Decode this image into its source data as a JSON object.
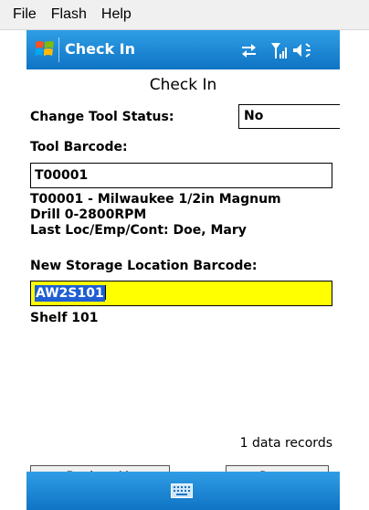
{
  "menubar": {
    "items": [
      "File",
      "Flash",
      "Help"
    ]
  },
  "titlebar": {
    "title": "Check In"
  },
  "form": {
    "heading": "Check In",
    "change_status_label": "Change Tool Status:",
    "change_status_value": "No",
    "tool_barcode_label": "Tool Barcode:",
    "tool_barcode_value": "T00001",
    "tool_description_line1": "T00001 - Milwaukee 1/2in Magnum",
    "tool_description_line2": "Drill 0-2800RPM",
    "last_loc_line": "Last Loc/Emp/Cont:  Doe, Mary",
    "storage_label": "New Storage Location Barcode:",
    "storage_value": "AW2S101",
    "storage_description": "Shelf 101",
    "record_count": "1 data records"
  },
  "buttons": {
    "back": "<- Back to Menu",
    "reset": "Reset"
  },
  "icons": {
    "start": "windows-flag-icon",
    "connectivity": "connectivity-arrows-icon",
    "signal": "signal-strength-icon",
    "volume": "speaker-icon",
    "keyboard": "keyboard-icon"
  },
  "colors": {
    "title_bar": "#1a86d8",
    "highlight_field": "#ffff00",
    "selection": "#1f5fd3"
  }
}
